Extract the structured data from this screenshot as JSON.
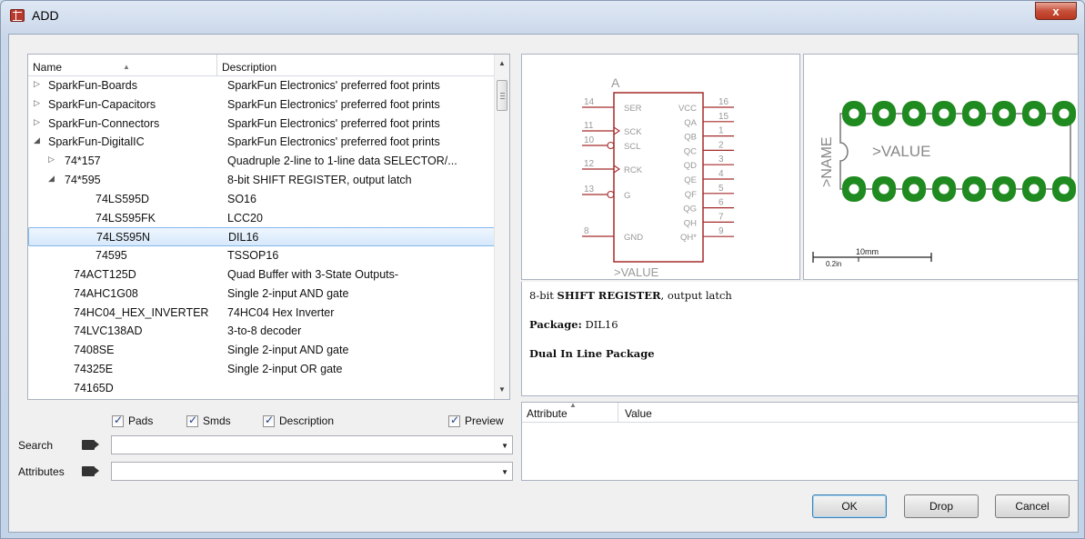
{
  "window": {
    "title": "ADD",
    "close_symbol": "x"
  },
  "list": {
    "col_name": "Name",
    "col_desc": "Description",
    "rows": [
      {
        "name": "SparkFun-Boards",
        "desc": "SparkFun Electronics' preferred foot prints",
        "level": 0,
        "expander": "collapsed"
      },
      {
        "name": "SparkFun-Capacitors",
        "desc": "SparkFun Electronics' preferred foot prints",
        "level": 0,
        "expander": "collapsed"
      },
      {
        "name": "SparkFun-Connectors",
        "desc": "SparkFun Electronics' preferred foot prints",
        "level": 0,
        "expander": "collapsed"
      },
      {
        "name": "SparkFun-DigitalIC",
        "desc": "SparkFun Electronics' preferred foot prints",
        "level": 0,
        "expander": "expanded"
      },
      {
        "name": "74*157",
        "desc": "Quadruple 2-line to 1-line data SELECTOR/...",
        "level": 1,
        "expander": "collapsed"
      },
      {
        "name": "74*595",
        "desc": "8-bit SHIFT REGISTER, output latch",
        "level": 1,
        "expander": "expanded"
      },
      {
        "name": "74LS595D",
        "desc": "SO16",
        "level": 2,
        "expander": ""
      },
      {
        "name": "74LS595FK",
        "desc": "LCC20",
        "level": 2,
        "expander": ""
      },
      {
        "name": "74LS595N",
        "desc": "DIL16",
        "level": 2,
        "expander": "",
        "selected": true
      },
      {
        "name": "74595",
        "desc": "TSSOP16",
        "level": 2,
        "expander": ""
      },
      {
        "name": "74ACT125D",
        "desc": "Quad Buffer with 3-State Outputs-",
        "level": 1,
        "expander": ""
      },
      {
        "name": "74AHC1G08",
        "desc": "Single 2-input AND gate",
        "level": 1,
        "expander": ""
      },
      {
        "name": "74HC04_HEX_INVERTER",
        "desc": "74HC04 Hex Inverter",
        "level": 1,
        "expander": ""
      },
      {
        "name": "74LVC138AD",
        "desc": "3-to-8 decoder",
        "level": 1,
        "expander": ""
      },
      {
        "name": "7408SE",
        "desc": "Single 2-input AND gate",
        "level": 1,
        "expander": ""
      },
      {
        "name": "74325E",
        "desc": "Single 2-input OR gate",
        "level": 1,
        "expander": ""
      },
      {
        "name": "74165D",
        "desc": "",
        "level": 1,
        "expander": ""
      }
    ]
  },
  "options": {
    "pads": "Pads",
    "smds": "Smds",
    "description": "Description",
    "preview": "Preview"
  },
  "search": {
    "label": "Search",
    "value": ""
  },
  "attributes_field": {
    "label": "Attributes",
    "value": ""
  },
  "symbol": {
    "name_label": "A",
    "value_label": ">VALUE",
    "pins_left": [
      {
        "num": "14",
        "name": "SER",
        "clock": false,
        "inverted": false
      },
      {
        "num": "11",
        "name": "SCK",
        "clock": true,
        "inverted": false
      },
      {
        "num": "10",
        "name": "SCL",
        "clock": false,
        "inverted": true
      },
      {
        "num": "12",
        "name": "RCK",
        "clock": true,
        "inverted": false
      },
      {
        "num": "13",
        "name": "G",
        "clock": false,
        "inverted": true
      },
      {
        "num": "8",
        "name": "GND",
        "clock": false,
        "inverted": false
      }
    ],
    "pins_right": [
      {
        "num": "16",
        "name": "VCC"
      },
      {
        "num": "15",
        "name": "QA"
      },
      {
        "num": "1",
        "name": "QB"
      },
      {
        "num": "2",
        "name": "QC"
      },
      {
        "num": "3",
        "name": "QD"
      },
      {
        "num": "4",
        "name": "QE"
      },
      {
        "num": "5",
        "name": "QF"
      },
      {
        "num": "6",
        "name": "QG"
      },
      {
        "num": "7",
        "name": "QH"
      },
      {
        "num": "9",
        "name": "QH*"
      }
    ]
  },
  "package": {
    "name_label": ">NAME",
    "value_label": ">VALUE",
    "scale_mm": "10mm",
    "scale_in": "0.2in",
    "pads_per_row": 8
  },
  "details": {
    "line1_prefix": "8-bit ",
    "line1_bold": "SHIFT REGISTER",
    "line1_suffix": ", output latch",
    "package_label": "Package:",
    "package_value": "DIL16",
    "package_long": "Dual In Line Package"
  },
  "attr_table": {
    "col_attribute": "Attribute",
    "col_value": "Value"
  },
  "buttons": {
    "ok": "OK",
    "drop": "Drop",
    "cancel": "Cancel"
  },
  "colors": {
    "symbol_line": "#a52a2a",
    "pad_green": "#1f8a1f",
    "selection": "#d6e8fb"
  }
}
